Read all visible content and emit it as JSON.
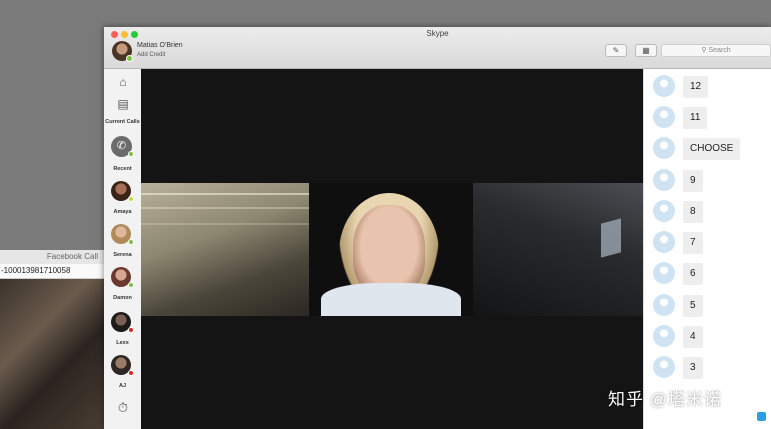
{
  "facebook_window": {
    "title": "Facebook Call",
    "url": "-100013981710058"
  },
  "skype_window": {
    "title": "Skype",
    "user_name": "Matias O'Brien",
    "credit_label": "Add Credit",
    "search_placeholder": "Search",
    "toolbar_icons": [
      "new-message-icon",
      "dialpad-icon"
    ]
  },
  "sidebar": {
    "home_icon": "home-icon",
    "contacts_icon": "contacts-book-icon",
    "current_calls_label": "Current Calls",
    "recent_label": "Recent",
    "contacts": [
      {
        "name": "Amaya",
        "status": "away",
        "status_color": "#c5d93b"
      },
      {
        "name": "Serena",
        "status": "online",
        "status_color": "#7cc242"
      },
      {
        "name": "Damon",
        "status": "online",
        "status_color": "#7cc242"
      },
      {
        "name": "Lexx",
        "status": "busy",
        "status_color": "#d9281c"
      },
      {
        "name": "AJ",
        "status": "busy",
        "status_color": "#d9281c"
      }
    ],
    "history_icon": "clock-icon"
  },
  "chat": {
    "messages": [
      "12",
      "11",
      "CHOOSE",
      "9",
      "8",
      "7",
      "6",
      "5",
      "4",
      "3"
    ]
  },
  "watermark": "知乎 @塔米诺",
  "colors": {
    "online": "#7cc242",
    "busy": "#d9281c",
    "away": "#c5d93b",
    "accent": "#2a9fe0"
  }
}
